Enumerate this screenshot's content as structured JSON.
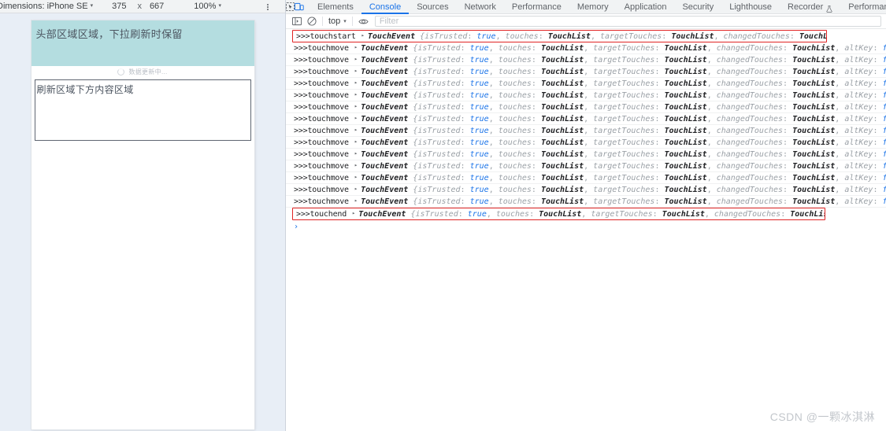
{
  "device_toolbar": {
    "dimensions_label": "Dimensions: iPhone SE",
    "width": "375",
    "times": "x",
    "height": "667",
    "zoom": "100%",
    "caret": "▾",
    "more_icon": "more-vertical-icon"
  },
  "viewport": {
    "header_text": "头部区域区域，下拉刷新时保留",
    "header_color": "#b4dde0",
    "loading_text": "数据更新中...",
    "content_text": "刷新区域下方内容区域"
  },
  "devtools": {
    "left_icons": [
      "inspect-icon",
      "device-toggle-icon"
    ],
    "tabs": [
      {
        "label": "Elements",
        "active": false,
        "flask": false
      },
      {
        "label": "Console",
        "active": true,
        "flask": false
      },
      {
        "label": "Sources",
        "active": false,
        "flask": false
      },
      {
        "label": "Network",
        "active": false,
        "flask": false
      },
      {
        "label": "Performance",
        "active": false,
        "flask": false
      },
      {
        "label": "Memory",
        "active": false,
        "flask": false
      },
      {
        "label": "Application",
        "active": false,
        "flask": false
      },
      {
        "label": "Security",
        "active": false,
        "flask": false
      },
      {
        "label": "Lighthouse",
        "active": false,
        "flask": false
      },
      {
        "label": "Recorder",
        "active": false,
        "flask": true
      },
      {
        "label": "Performance insights",
        "active": false,
        "flask": true
      }
    ],
    "accent_color": "#1a73e8"
  },
  "console_toolbar": {
    "sidebar_icon": "console-sidebar-icon",
    "clear_icon": "clear-console-icon",
    "context": "top",
    "context_caret": "▾",
    "eye_icon": "live-expression-eye-icon",
    "filter_placeholder": "Filter"
  },
  "console": {
    "prompt": "›",
    "highlight_color": "#e02424",
    "messages": [
      {
        "label": ">>>touchstart",
        "class": "TouchEvent",
        "highlight": true
      },
      {
        "label": ">>>touchmove",
        "class": "TouchEvent",
        "highlight": false
      },
      {
        "label": ">>>touchmove",
        "class": "TouchEvent",
        "highlight": false
      },
      {
        "label": ">>>touchmove",
        "class": "TouchEvent",
        "highlight": false
      },
      {
        "label": ">>>touchmove",
        "class": "TouchEvent",
        "highlight": false
      },
      {
        "label": ">>>touchmove",
        "class": "TouchEvent",
        "highlight": false
      },
      {
        "label": ">>>touchmove",
        "class": "TouchEvent",
        "highlight": false
      },
      {
        "label": ">>>touchmove",
        "class": "TouchEvent",
        "highlight": false
      },
      {
        "label": ">>>touchmove",
        "class": "TouchEvent",
        "highlight": false
      },
      {
        "label": ">>>touchmove",
        "class": "TouchEvent",
        "highlight": false
      },
      {
        "label": ">>>touchmove",
        "class": "TouchEvent",
        "highlight": false
      },
      {
        "label": ">>>touchmove",
        "class": "TouchEvent",
        "highlight": false
      },
      {
        "label": ">>>touchmove",
        "class": "TouchEvent",
        "highlight": false
      },
      {
        "label": ">>>touchmove",
        "class": "TouchEvent",
        "highlight": false
      },
      {
        "label": ">>>touchmove",
        "class": "TouchEvent",
        "highlight": false
      },
      {
        "label": ">>>touchend",
        "class": "TouchEvent",
        "highlight": true
      }
    ],
    "props": [
      {
        "key": "isTrusted",
        "value": "true",
        "kind": "bool"
      },
      {
        "key": "touches",
        "value": "TouchList",
        "kind": "obj"
      },
      {
        "key": "targetTouches",
        "value": "TouchList",
        "kind": "obj"
      },
      {
        "key": "changedTouches",
        "value": "TouchList",
        "kind": "obj"
      },
      {
        "key": "altKey",
        "value": "false",
        "kind": "bool"
      }
    ],
    "ellipsis": "…}",
    "open_brace": "{",
    "expand_triangle": "▸"
  },
  "watermark": {
    "text": "CSDN @一颗冰淇淋"
  }
}
